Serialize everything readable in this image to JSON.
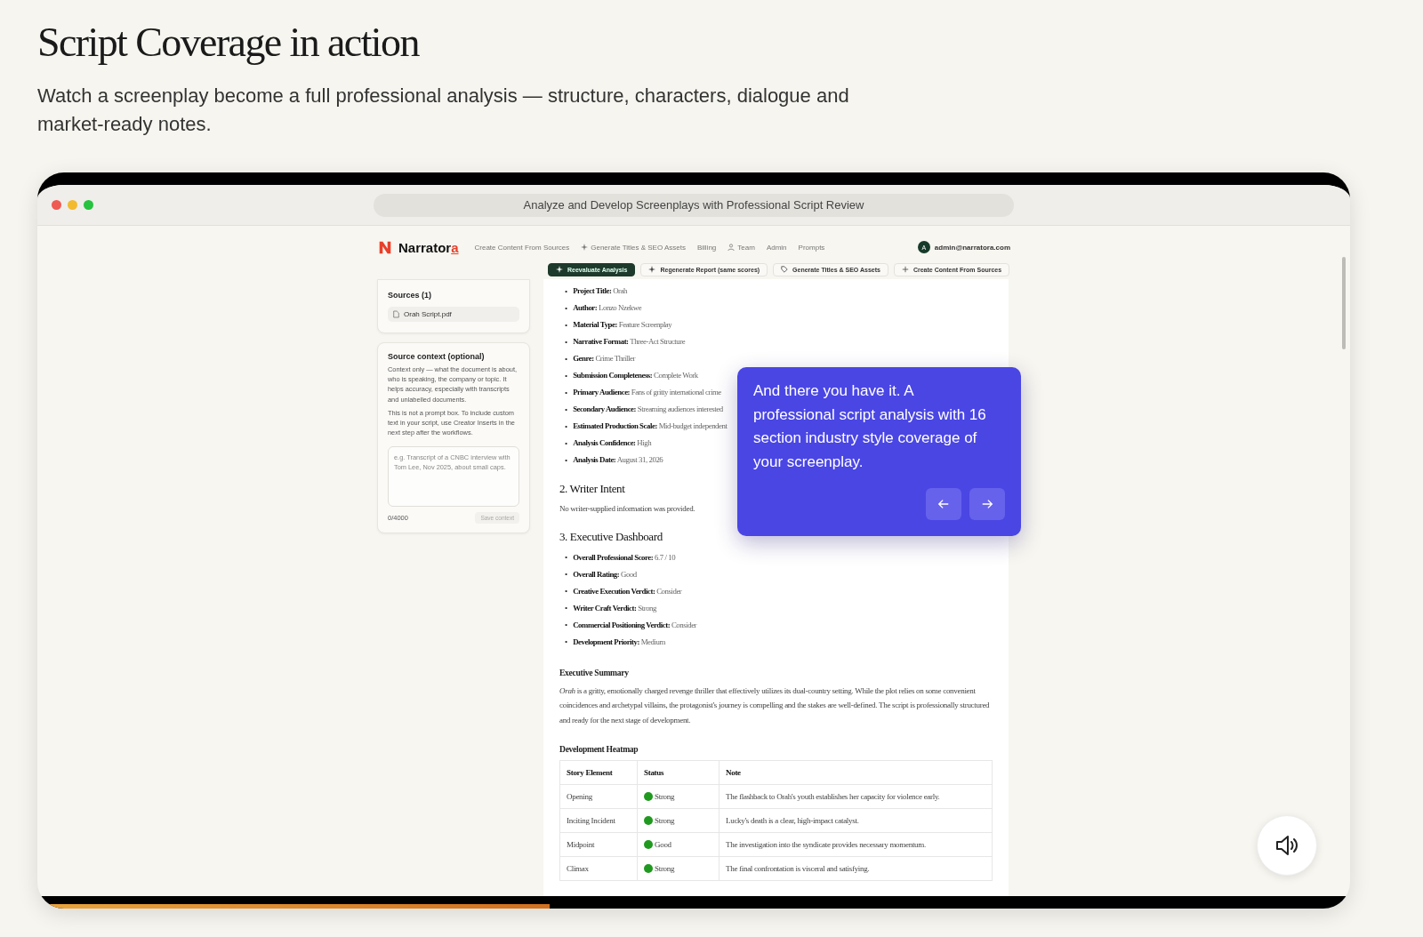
{
  "page": {
    "title": "Script Coverage in action",
    "subtitle": "Watch a screenplay become a full professional analysis — structure, characters, dialogue and market-ready notes."
  },
  "video": {
    "progress": {
      "level": 0.39
    },
    "browser": {
      "address": "Analyze and Develop Screenplays with Professional Script Review"
    },
    "app": {
      "brand": {
        "name": "Narrator",
        "accent": "a"
      },
      "nav": [
        {
          "label": "Create Content From Sources",
          "kind": "plain"
        },
        {
          "label": "Generate Titles & SEO Assets",
          "kind": "sparkle"
        },
        {
          "label": "Billing",
          "kind": "plain"
        },
        {
          "label": "Team",
          "kind": "person"
        },
        {
          "label": "Admin",
          "kind": "plain"
        },
        {
          "label": "Prompts",
          "kind": "plain"
        }
      ],
      "user": {
        "initial": "A",
        "email": "admin@narratora.com"
      },
      "toolbar": [
        {
          "label": "Reevaluate Analysis",
          "primary": true,
          "kind": "sparkle"
        },
        {
          "label": "Regenerate Report (same scores)",
          "primary": false,
          "kind": "sparkle"
        },
        {
          "label": "Generate Titles & SEO Assets",
          "primary": false,
          "kind": "tag"
        },
        {
          "label": "Create Content From Sources",
          "primary": false,
          "kind": "plus"
        }
      ],
      "sources": {
        "heading": "Sources (1)",
        "files": [
          "Orah Script.pdf"
        ]
      },
      "context": {
        "heading": "Source context (optional)",
        "paragraphs": [
          "Context only — what the document is about, who is speaking, the company or topic. It helps accuracy, especially with transcripts and unlabelled documents.",
          "This is not a prompt box. To include custom text in your script, use Creator Inserts in the next step after the workflows."
        ],
        "placeholder": "e.g. Transcript of a CNBC interview with Tom Lee, Nov 2025, about small caps.",
        "count": "0/4000",
        "button": "Save context"
      },
      "document": {
        "blocks": [
          {
            "kind": "list",
            "items": [
              {
                "bullet": "•",
                "label": "Project Title:",
                "value": "Orah"
              },
              {
                "bullet": "•",
                "label": "Author:",
                "value": "Lonzo Nzekwe"
              },
              {
                "bullet": "•",
                "label": "Material Type:",
                "value": "Feature Screenplay"
              },
              {
                "bullet": "•",
                "label": "Narrative Format:",
                "value": "Three-Act Structure"
              },
              {
                "bullet": "•",
                "label": "Genre:",
                "value": "Crime Thriller"
              },
              {
                "bullet": "•",
                "label": "Submission Completeness:",
                "value": "Complete Work"
              },
              {
                "bullet": "•",
                "label": "Primary Audience:",
                "value": "Fans of gritty international crime"
              },
              {
                "bullet": "•",
                "label": "Secondary Audience:",
                "value": "Streaming audiences interested"
              },
              {
                "bullet": "•",
                "label": "Estimated Production Scale:",
                "value": "Mid-budget independent"
              },
              {
                "bullet": "•",
                "label": "Analysis Confidence:",
                "value": "High"
              },
              {
                "bullet": "•",
                "label": "Analysis Date:",
                "value": "August 31, 2026"
              }
            ]
          },
          {
            "kind": "heading",
            "text": "2. Writer Intent"
          },
          {
            "kind": "paragraph",
            "text": "No writer-supplied information was provided."
          },
          {
            "kind": "heading",
            "text": "3. Executive Dashboard"
          },
          {
            "kind": "list",
            "items": [
              {
                "bullet": "•",
                "label": "Overall Professional Score:",
                "value": "6.7 / 10"
              },
              {
                "bullet": "•",
                "label": "Overall Rating:",
                "value": "Good"
              },
              {
                "bullet": "•",
                "label": "Creative Execution Verdict:",
                "value": "Consider"
              },
              {
                "bullet": "•",
                "label": "Writer Craft Verdict:",
                "value": "Strong"
              },
              {
                "bullet": "•",
                "label": "Commercial Positioning Verdict:",
                "value": "Consider"
              },
              {
                "bullet": "•",
                "label": "Development Priority:",
                "value": "Medium"
              }
            ]
          },
          {
            "kind": "subheading",
            "text": "Executive Summary"
          },
          {
            "kind": "paragraph",
            "text": "*Orah* is a gritty, emotionally charged revenge thriller that effectively utilizes its dual-country setting. While the plot relies on some convenient coincidences and archetypal villains, the protagonist's journey is compelling and the stakes are well-defined. The script is professionally structured and ready for the next stage of development."
          },
          {
            "kind": "subheading",
            "text": "Development Heatmap"
          },
          {
            "kind": "table",
            "columns": [
              "Story Element",
              "Status",
              "Note"
            ],
            "rows": [
              {
                "element": "Opening",
                "status": "Strong",
                "color": "#1f9a1f",
                "note": "The flashback to Orah's youth establishes her capacity for violence early."
              },
              {
                "element": "Inciting Incident",
                "status": "Strong",
                "color": "#1f9a1f",
                "note": "Lucky's death is a clear, high-impact catalyst."
              },
              {
                "element": "Midpoint",
                "status": "Good",
                "color": "#1f9a1f",
                "note": "The investigation into the syndicate provides necessary momentum."
              },
              {
                "element": "Climax",
                "status": "Strong",
                "color": "#1f9a1f",
                "note": "The final confrontation is visceral and satisfying."
              }
            ]
          }
        ]
      }
    },
    "tooltip": {
      "text": "And there you have it. A professional script analysis with 16 section industry style coverage of your screenplay."
    }
  }
}
